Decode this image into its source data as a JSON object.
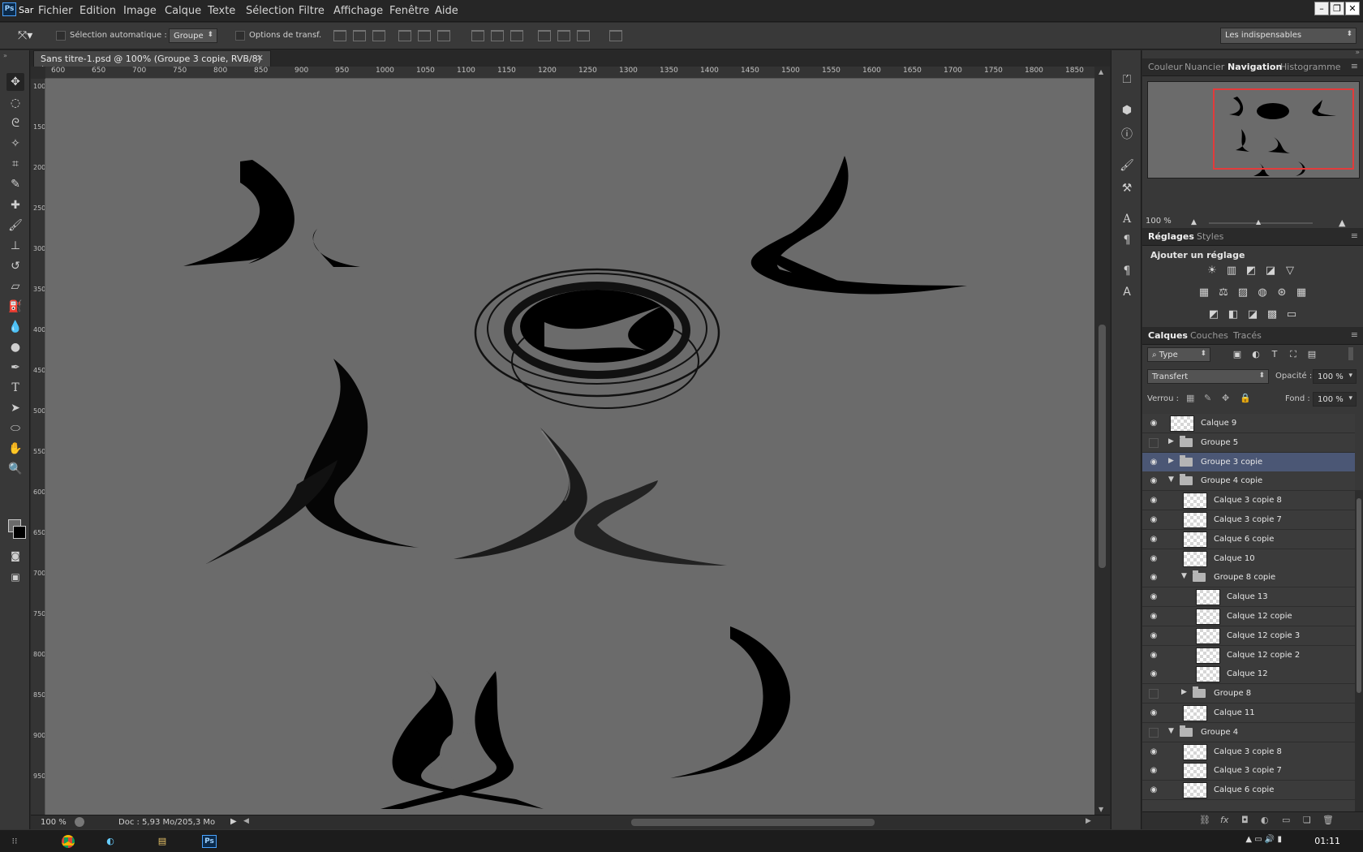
{
  "app": {
    "icon_label": "Ps",
    "name": "Sar"
  },
  "menu": [
    "Fichier",
    "Edition",
    "Image",
    "Calque",
    "Texte",
    "Sélection",
    "Filtre",
    "Affichage",
    "Fenêtre",
    "Aide"
  ],
  "window_controls": {
    "minimize": "–",
    "restore": "❐",
    "close": "✕"
  },
  "options": {
    "auto_select_label": "Sélection automatique :",
    "auto_select_value": "Groupe",
    "transform_label": "Options de transf.",
    "workspace": "Les indispensables"
  },
  "tools": [
    "move-tool",
    "marquee-tool",
    "lasso-tool",
    "quick-select-tool",
    "crop-tool",
    "eyedropper-tool",
    "healing-tool",
    "brush-tool",
    "stamp-tool",
    "history-brush-tool",
    "eraser-tool",
    "bucket-tool",
    "blur-tool",
    "dodge-tool",
    "pen-tool",
    "type-tool",
    "path-select-tool",
    "shape-tool",
    "hand-tool",
    "zoom-tool"
  ],
  "document": {
    "tab_title": "Sans titre-1.psd @ 100% (Groupe 3 copie, RVB/8) *",
    "close": "✕",
    "ruler_top": [
      "600",
      "650",
      "700",
      "750",
      "800",
      "850",
      "900",
      "950",
      "1000",
      "1050",
      "1100",
      "1150",
      "1200",
      "1250",
      "1300",
      "1350",
      "1400",
      "1450",
      "1500",
      "1550",
      "1600",
      "1650",
      "1700",
      "1750",
      "1800",
      "1850"
    ],
    "ruler_left": [
      "100",
      "150",
      "200",
      "250",
      "300",
      "350",
      "400",
      "450",
      "500",
      "550",
      "600",
      "650",
      "700",
      "750",
      "800",
      "850",
      "900",
      "950"
    ],
    "zoom": "100 %",
    "doc_info": "Doc : 5,93 Mo/205,3 Mo"
  },
  "nav_panel": {
    "tabs": [
      "Couleur",
      "Nuancier",
      "Navigation",
      "Histogramme"
    ],
    "active_tab": "Navigation",
    "zoom": "100 %"
  },
  "adjust_panel": {
    "tabs": [
      "Réglages",
      "Styles"
    ],
    "heading": "Ajouter un réglage",
    "icons_row1": [
      "☀",
      "▥",
      "◩",
      "◪",
      "▽"
    ],
    "icons_row2": [
      "▦",
      "⚖",
      "▨",
      "◍",
      "⊛",
      "▦"
    ],
    "icons_row3": [
      "◩",
      "◧",
      "◪",
      "▩",
      "▭"
    ]
  },
  "layers_panel": {
    "tabs": [
      "Calques",
      "Couches",
      "Tracés"
    ],
    "filter": "Type",
    "filter_icons": [
      "▣",
      "◐",
      "T",
      "⛶",
      "▤"
    ],
    "blend_mode": "Transfert",
    "opacity_label": "Opacité :",
    "opacity": "100 %",
    "lock_label": "Verrou :",
    "fill_label": "Fond :",
    "fill": "100 %",
    "rows": [
      {
        "name": "Calque 9",
        "type": "layer",
        "indent": 0,
        "visible": true,
        "selected": false
      },
      {
        "name": "Groupe 5",
        "type": "group-closed",
        "indent": 0,
        "visible": false,
        "selected": false
      },
      {
        "name": "Groupe 3 copie",
        "type": "group-closed",
        "indent": 0,
        "visible": true,
        "selected": true
      },
      {
        "name": "Groupe 4 copie",
        "type": "group-open",
        "indent": 0,
        "visible": true,
        "selected": false
      },
      {
        "name": "Calque 3 copie 8",
        "type": "layer",
        "indent": 1,
        "visible": true,
        "selected": false
      },
      {
        "name": "Calque 3 copie 7",
        "type": "layer",
        "indent": 1,
        "visible": true,
        "selected": false
      },
      {
        "name": "Calque 6 copie",
        "type": "layer",
        "indent": 1,
        "visible": true,
        "selected": false
      },
      {
        "name": "Calque 10",
        "type": "layer",
        "indent": 1,
        "visible": true,
        "selected": false
      },
      {
        "name": "Groupe 8 copie",
        "type": "group-open",
        "indent": 1,
        "visible": true,
        "selected": false
      },
      {
        "name": "Calque 13",
        "type": "layer",
        "indent": 2,
        "visible": true,
        "selected": false
      },
      {
        "name": "Calque 12 copie",
        "type": "layer",
        "indent": 2,
        "visible": true,
        "selected": false
      },
      {
        "name": "Calque 12 copie 3",
        "type": "layer",
        "indent": 2,
        "visible": true,
        "selected": false
      },
      {
        "name": "Calque 12 copie 2",
        "type": "layer",
        "indent": 2,
        "visible": true,
        "selected": false
      },
      {
        "name": "Calque 12",
        "type": "layer",
        "indent": 2,
        "visible": true,
        "selected": false
      },
      {
        "name": "Groupe 8",
        "type": "group-closed",
        "indent": 1,
        "visible": false,
        "selected": false
      },
      {
        "name": "Calque 11",
        "type": "layer",
        "indent": 1,
        "visible": true,
        "selected": false
      },
      {
        "name": "Groupe 4",
        "type": "group-open",
        "indent": 0,
        "visible": false,
        "selected": false
      },
      {
        "name": "Calque 3 copie 8",
        "type": "layer",
        "indent": 1,
        "visible": true,
        "selected": false
      },
      {
        "name": "Calque 3 copie 7",
        "type": "layer",
        "indent": 1,
        "visible": true,
        "selected": false
      },
      {
        "name": "Calque 6 copie",
        "type": "layer",
        "indent": 1,
        "visible": true,
        "selected": false
      }
    ],
    "footer_icons": [
      "⛓",
      "fx",
      "◘",
      "◐",
      "▭",
      "❏",
      "🗑"
    ]
  },
  "taskbar": {
    "apps": [
      "chrome-app",
      "media-app",
      "explorer-app",
      "photoshop-app"
    ],
    "ps_label": "Ps",
    "clock": "01:11"
  },
  "colors": {
    "canvas": "#6b6b6b",
    "panel": "#383838",
    "selection": "#4b5775",
    "nav_frame": "#e23b3b"
  }
}
